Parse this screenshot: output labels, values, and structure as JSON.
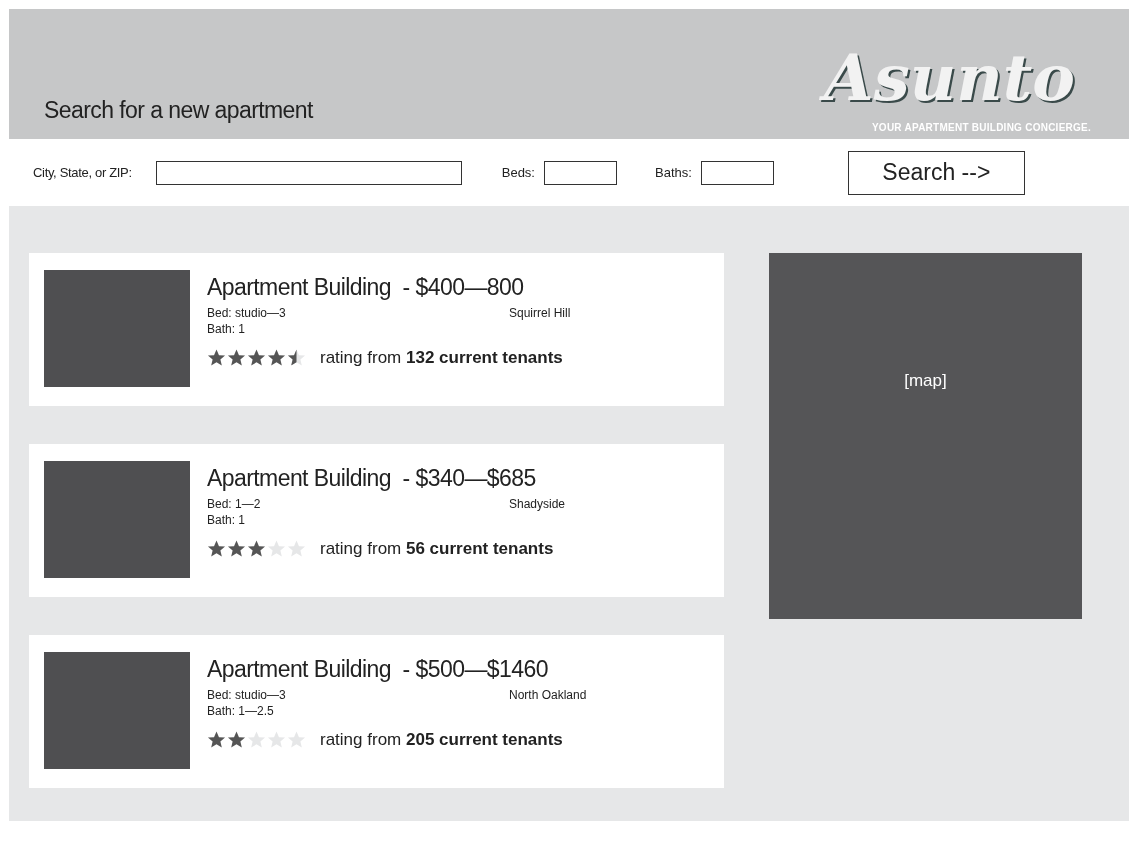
{
  "header": {
    "heading": "Search for a new apartment",
    "logo": "Asunto",
    "tagline": "YOUR APARTMENT BUILDING CONCIERGE."
  },
  "search": {
    "location_label": "City, State, or ZIP:",
    "beds_label": "Beds:",
    "baths_label": "Baths:",
    "button": "Search -->"
  },
  "listings": [
    {
      "kind": "picture",
      "title": "Apartment Building  - $400—800",
      "beds": "Bed: studio—3",
      "baths": "Bath: 1",
      "neighborhood": "Squirrel Hill",
      "stars": 4.5,
      "rating": "rating from **132 current tenants**"
    },
    {
      "kind": "picture",
      "title": "Apartment Building  - $340—$685",
      "beds": "Bed: 1—2",
      "baths": "Bath: 1",
      "neighborhood": "Shadyside",
      "stars": 3,
      "rating": "rating from **56 current tenants**"
    },
    {
      "kind": "picture",
      "title": "Apartment Building  - $500—$1460",
      "beds": "Bed: studio—3",
      "baths": "Bath: 1—2.5",
      "neighborhood": "North Oakland",
      "stars": 2,
      "rating": "rating from **205 current tenants**"
    }
  ],
  "map": {
    "label": "[map]"
  }
}
